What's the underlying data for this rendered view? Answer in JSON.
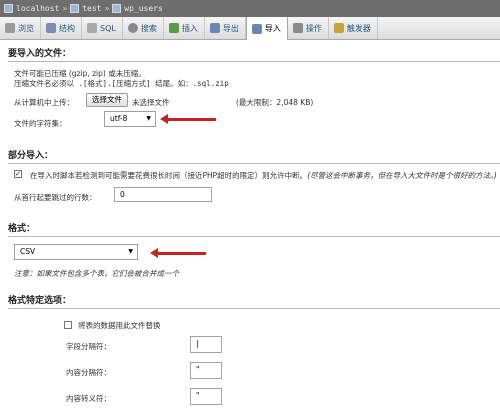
{
  "breadcrumb": {
    "server": "localhost",
    "database": "test",
    "table": "wp_users"
  },
  "tabs": [
    {
      "label": "浏览",
      "icon": "browse-icon",
      "color": "#9a9a9a"
    },
    {
      "label": "结构",
      "icon": "structure-icon",
      "color": "#7c8fb0"
    },
    {
      "label": "SQL",
      "icon": "sql-icon",
      "color": "#a9a9a9"
    },
    {
      "label": "搜索",
      "icon": "search-icon",
      "color": "#8a8a8a"
    },
    {
      "label": "插入",
      "icon": "insert-icon",
      "color": "#5c9a4a"
    },
    {
      "label": "导出",
      "icon": "export-icon",
      "color": "#6a87b2"
    },
    {
      "label": "导入",
      "icon": "import-icon",
      "color": "#6a87b2"
    },
    {
      "label": "操作",
      "icon": "operations-icon",
      "color": "#8a8a8a"
    },
    {
      "label": "触发器",
      "icon": "triggers-icon",
      "color": "#c9a33a"
    }
  ],
  "import_file": {
    "heading": "要导入的文件：",
    "line1": "文件可能已压缩 (gzip, zip) 或未压缩。",
    "line2": "压缩文件名必须以 .[格式].[压缩方式] 结尾。如：.sql.zip",
    "upload_label": "从计算机中上传：",
    "choose_button": "选择文件",
    "no_file": "未选择文件",
    "limit": "(最大限制：2,048 KB)",
    "charset_label": "文件的字符集：",
    "charset_value": "utf-8"
  },
  "partial": {
    "heading": "部分导入：",
    "allow_interrupt": "在导入时脚本若检测到可能需要花费很长时间（接近PHP超时的限定）则允许中断。",
    "allow_interrupt_note": "(尽管这会中断事务，但在导入大文件时是个很好的方法。)",
    "skip_label": "从首行起要跳过的行数：",
    "skip_value": "0"
  },
  "format": {
    "heading": "格式：",
    "value": "CSV",
    "note": "注意：如果文件包含多个表，它们会被合并成一个"
  },
  "format_options": {
    "heading": "格式特定选项：",
    "replace_label": "将表的数据用此文件替换",
    "field_sep_label": "字段分隔符：",
    "field_sep_value": "|",
    "enclosed_label": "内容分隔符：",
    "enclosed_value": "\"",
    "escaped_label": "内容转义符：",
    "escaped_value": "\""
  },
  "colors": {
    "arrow": "#c8231f",
    "link": "#235a81"
  }
}
